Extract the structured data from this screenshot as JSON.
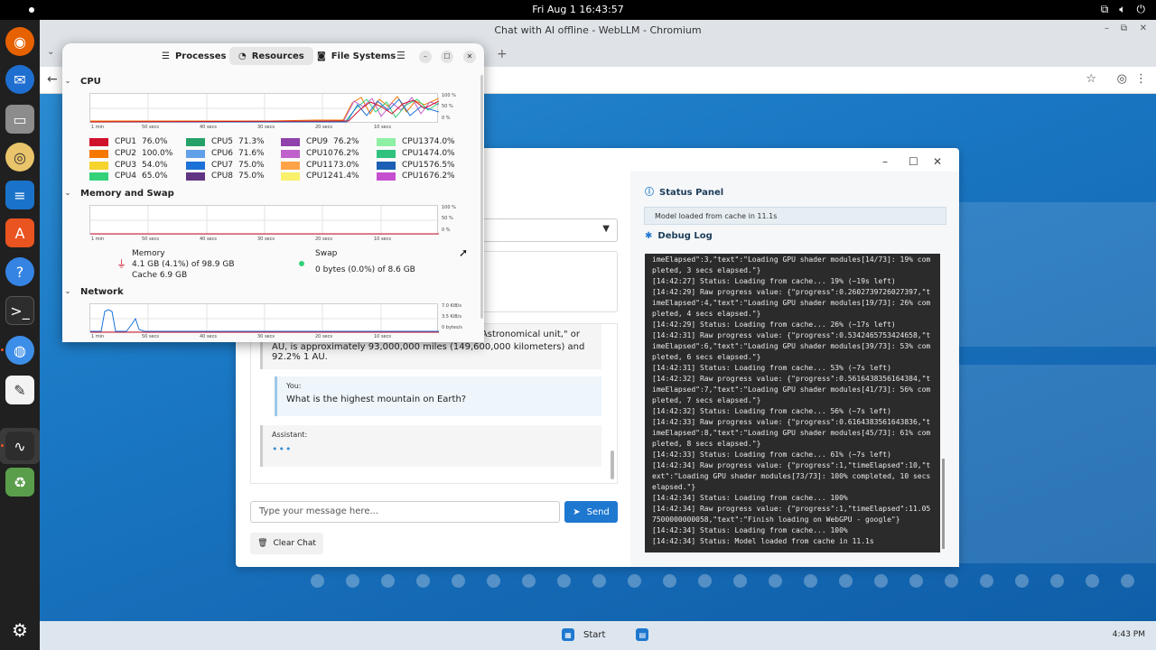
{
  "system": {
    "clock": "Fri Aug 1  16:43:57",
    "tray_icons": [
      "network-icon",
      "volume-icon",
      "power-icon"
    ]
  },
  "dock": {
    "items": [
      "firefox-icon",
      "thunderbird-icon",
      "files-icon",
      "rhythmbox-icon",
      "writer-icon",
      "app-center-icon",
      "help-icon",
      "terminal-icon",
      "chromium-icon",
      "text-editor-icon",
      "system-monitor-icon",
      "trash-icon",
      "ubuntu-icon"
    ]
  },
  "browser": {
    "window_title": "Chat with AI offline - WebLLM - Chromium"
  },
  "sysmon": {
    "tabs": [
      "Processes",
      "Resources",
      "File Systems"
    ],
    "active_tab": "Resources",
    "sections": {
      "cpu": "CPU",
      "memory": "Memory and Swap",
      "network": "Network"
    },
    "time_ticks": [
      "1 min",
      "50 secs",
      "40 secs",
      "30 secs",
      "20 secs",
      "10 secs"
    ],
    "pct_ticks": [
      "100 %",
      "50 %",
      "0 %"
    ],
    "net_ticks": [
      "7.0 KiB/s",
      "3.5 KiB/s",
      "0 bytes/s"
    ],
    "cpus": [
      {
        "name": "CPU1",
        "value": "76.0%",
        "color": "#d0112b"
      },
      {
        "name": "CPU2",
        "value": "100.0%",
        "color": "#f57900"
      },
      {
        "name": "CPU3",
        "value": "54.0%",
        "color": "#f6d32d"
      },
      {
        "name": "CPU4",
        "value": "65.0%",
        "color": "#33d17a"
      },
      {
        "name": "CPU5",
        "value": "71.3%",
        "color": "#26a269"
      },
      {
        "name": "CPU6",
        "value": "71.6%",
        "color": "#62a0ea"
      },
      {
        "name": "CPU7",
        "value": "75.0%",
        "color": "#1c71d8"
      },
      {
        "name": "CPU8",
        "value": "75.0%",
        "color": "#613583"
      },
      {
        "name": "CPU9",
        "value": "76.2%",
        "color": "#9141ac"
      },
      {
        "name": "CPU10",
        "value": "76.2%",
        "color": "#c061cb"
      },
      {
        "name": "CPU11",
        "value": "73.0%",
        "color": "#ffa348"
      },
      {
        "name": "CPU12",
        "value": "41.4%",
        "color": "#f9f06b"
      },
      {
        "name": "CPU13",
        "value": "74.0%",
        "color": "#8ff0a4"
      },
      {
        "name": "CPU14",
        "value": "74.0%",
        "color": "#2ec27e"
      },
      {
        "name": "CPU15",
        "value": "76.5%",
        "color": "#1a5fb4"
      },
      {
        "name": "CPU16",
        "value": "76.2%",
        "color": "#c64fd0"
      }
    ],
    "memory": {
      "label": "Memory",
      "usage": "4.1 GB (4.1%) of 98.9 GB",
      "cache": "Cache 6.9 GB",
      "color": "#d0112b"
    },
    "swap": {
      "label": "Swap",
      "usage": "0 bytes (0.0%) of 8.6 GB",
      "color": "#33d17a"
    }
  },
  "chat": {
    "messages": [
      {
        "who": "",
        "text_line1": "h as a \"Astronomical unit,\" or",
        "text_line2": "AU, is approximately 93,000,000 miles (149,600,000 kilometers) and 92.2% 1 AU."
      },
      {
        "who": "You:",
        "text": "What is the highest mountain on Earth?"
      },
      {
        "who": "Assistant:",
        "text": ""
      }
    ],
    "input_placeholder": "Type your message here...",
    "send_label": "Send",
    "clear_label": "Clear Chat"
  },
  "status_panel": {
    "title": "Status Panel",
    "status": "Model loaded from cache in 11.1s"
  },
  "debug_log": {
    "title": "Debug Log",
    "lines": [
      "imeElapsed\":3,\"text\":\"Loading GPU shader modules[14/73]: 19% completed, 3 secs elapsed.\"}",
      "[14:42:27] Status: Loading from cache... 19% (~19s left)",
      "[14:42:29] Raw progress value: {\"progress\":0.2602739726027397,\"timeElapsed\":4,\"text\":\"Loading GPU shader modules[19/73]: 26% completed, 4 secs elapsed.\"}",
      "[14:42:29] Status: Loading from cache... 26% (~17s left)",
      "[14:42:31] Raw progress value: {\"progress\":0.5342465753424658,\"timeElapsed\":6,\"text\":\"Loading GPU shader modules[39/73]: 53% completed, 6 secs elapsed.\"}",
      "[14:42:31] Status: Loading from cache... 53% (~7s left)",
      "[14:42:32] Raw progress value: {\"progress\":0.5616438356164384,\"timeElapsed\":7,\"text\":\"Loading GPU shader modules[41/73]: 56% completed, 7 secs elapsed.\"}",
      "[14:42:32] Status: Loading from cache... 56% (~7s left)",
      "[14:42:33] Raw progress value: {\"progress\":0.6164383561643836,\"timeElapsed\":8,\"text\":\"Loading GPU shader modules[45/73]: 61% completed, 8 secs elapsed.\"}",
      "[14:42:33] Status: Loading from cache... 61% (~7s left)",
      "[14:42:34] Raw progress value: {\"progress\":1,\"timeElapsed\":10,\"text\":\"Loading GPU shader modules[73/73]: 100% completed, 10 secs elapsed.\"}",
      "[14:42:34] Status: Loading from cache... 100%",
      "[14:42:34] Raw progress value: {\"progress\":1,\"timeElapsed\":11.057500000000058,\"text\":\"Finish loading on WebGPU - google\"}",
      "[14:42:34] Status: Loading from cache... 100%",
      "[14:42:34] Status: Model loaded from cache in 11.1s"
    ]
  },
  "taskbar": {
    "start_label": "Start",
    "clock": "4:43 PM"
  }
}
